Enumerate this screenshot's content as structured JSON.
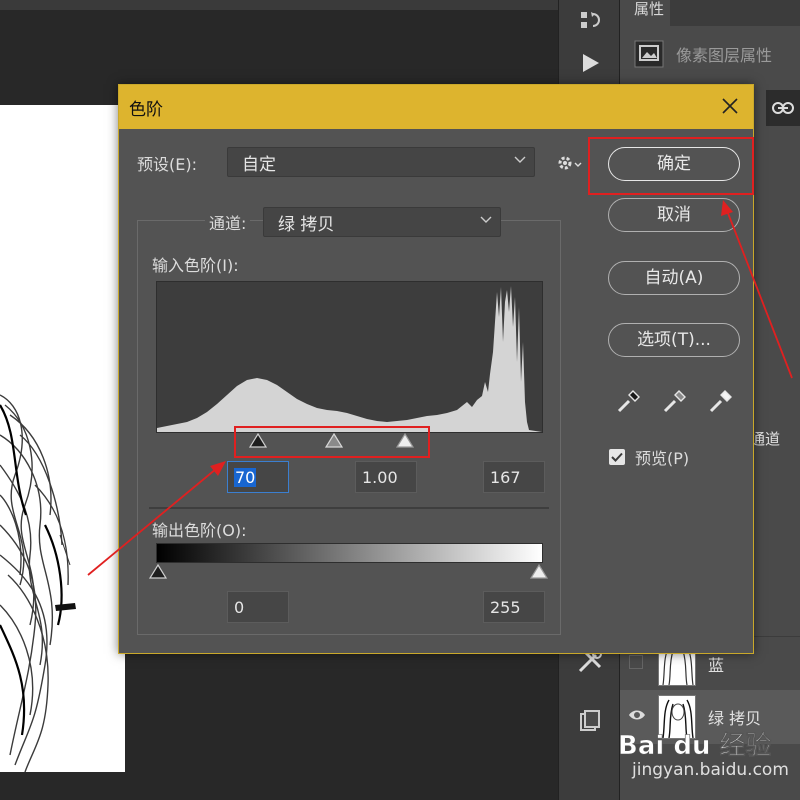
{
  "dialog": {
    "title": "色阶",
    "preset_label": "预设(E):",
    "preset_value": "自定",
    "channel_label": "通道:",
    "channel_value": "绿 拷贝",
    "input_levels_label": "输入色阶(I):",
    "input_black": "70",
    "input_gamma": "1.00",
    "input_white": "167",
    "output_levels_label": "输出色阶(O):",
    "output_black": "0",
    "output_white": "255",
    "buttons": {
      "ok": "确定",
      "cancel": "取消",
      "auto": "自动(A)",
      "options": "选项(T)..."
    },
    "preview_label": "预览(P)",
    "preview_checked": true
  },
  "panel": {
    "properties_tab": "属性",
    "properties_header": "像素图层属性",
    "channels_tab_partial": "通道",
    "layers": [
      {
        "name": "蓝",
        "visible": false
      },
      {
        "name": "绿 拷贝",
        "visible": true
      }
    ]
  },
  "watermark": {
    "brand": "Bai du 经验",
    "url": "jingyan.baidu.com"
  },
  "colors": {
    "titlebar": "#ddb42e",
    "dialog_bg": "#535353",
    "annotation": "#e02020",
    "selection": "#1866d1"
  }
}
